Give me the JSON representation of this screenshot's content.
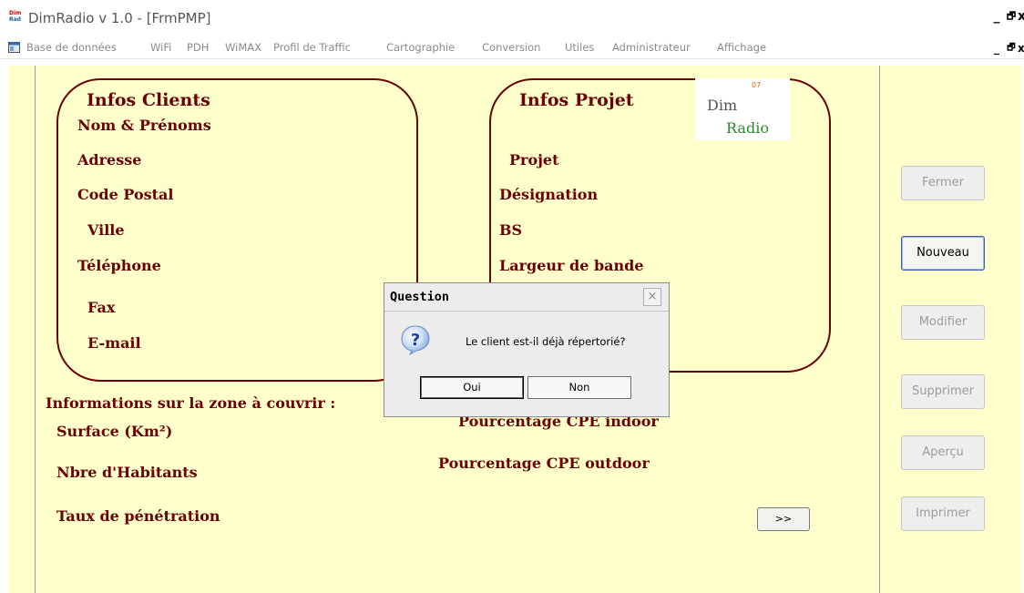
{
  "window": {
    "title": "DimRadio v 1.0 - [FrmPMP]",
    "app_icon_text_top": "Dim",
    "app_icon_text_bottom": "Rad",
    "minimize": "_",
    "restore": "🗗",
    "close": "x"
  },
  "menu": {
    "items": [
      "Base de données",
      "WiFi",
      "PDH",
      "WiMAX",
      "Profil de Traffic",
      "Cartographie",
      "Conversion",
      "Utiles",
      "Administrateur",
      "Affichage"
    ]
  },
  "clients": {
    "heading": "Infos Clients",
    "fields": [
      "Nom & Prénoms",
      "Adresse",
      "Code Postal",
      "Ville",
      "Téléphone",
      "Fax",
      "E-mail"
    ]
  },
  "projet": {
    "heading": "Infos Projet",
    "fields": [
      "Projet",
      "Désignation",
      "BS",
      "Largeur de bande"
    ]
  },
  "logo": {
    "number": "07",
    "line1": "Dim",
    "line2": "Radio"
  },
  "zone": {
    "heading": "Informations sur la zone à couvrir :",
    "fields": [
      "Surface (Km²)",
      "Nbre d'Habitants",
      "Taux de pénétration"
    ],
    "cpe_indoor": "Pourcentage CPE indoor",
    "cpe_outdoor": "Pourcentage CPE outdoor",
    "next_label": ">>"
  },
  "sidebar": {
    "buttons": [
      {
        "label": "Fermer",
        "enabled": false
      },
      {
        "label": "Nouveau",
        "enabled": true
      },
      {
        "label": "Modifier",
        "enabled": false
      },
      {
        "label": "Supprimer",
        "enabled": false
      },
      {
        "label": "Aperçu",
        "enabled": false
      },
      {
        "label": "Imprimer",
        "enabled": false
      }
    ]
  },
  "dialog": {
    "title": "Question",
    "close": "×",
    "icon": "question-icon",
    "message": "Le client est-il déjà répertorié?",
    "yes": "Oui",
    "no": "Non"
  },
  "colors": {
    "form_background": "#ffffcc",
    "label_text": "#6b0000",
    "dialog_background": "#ececec"
  }
}
